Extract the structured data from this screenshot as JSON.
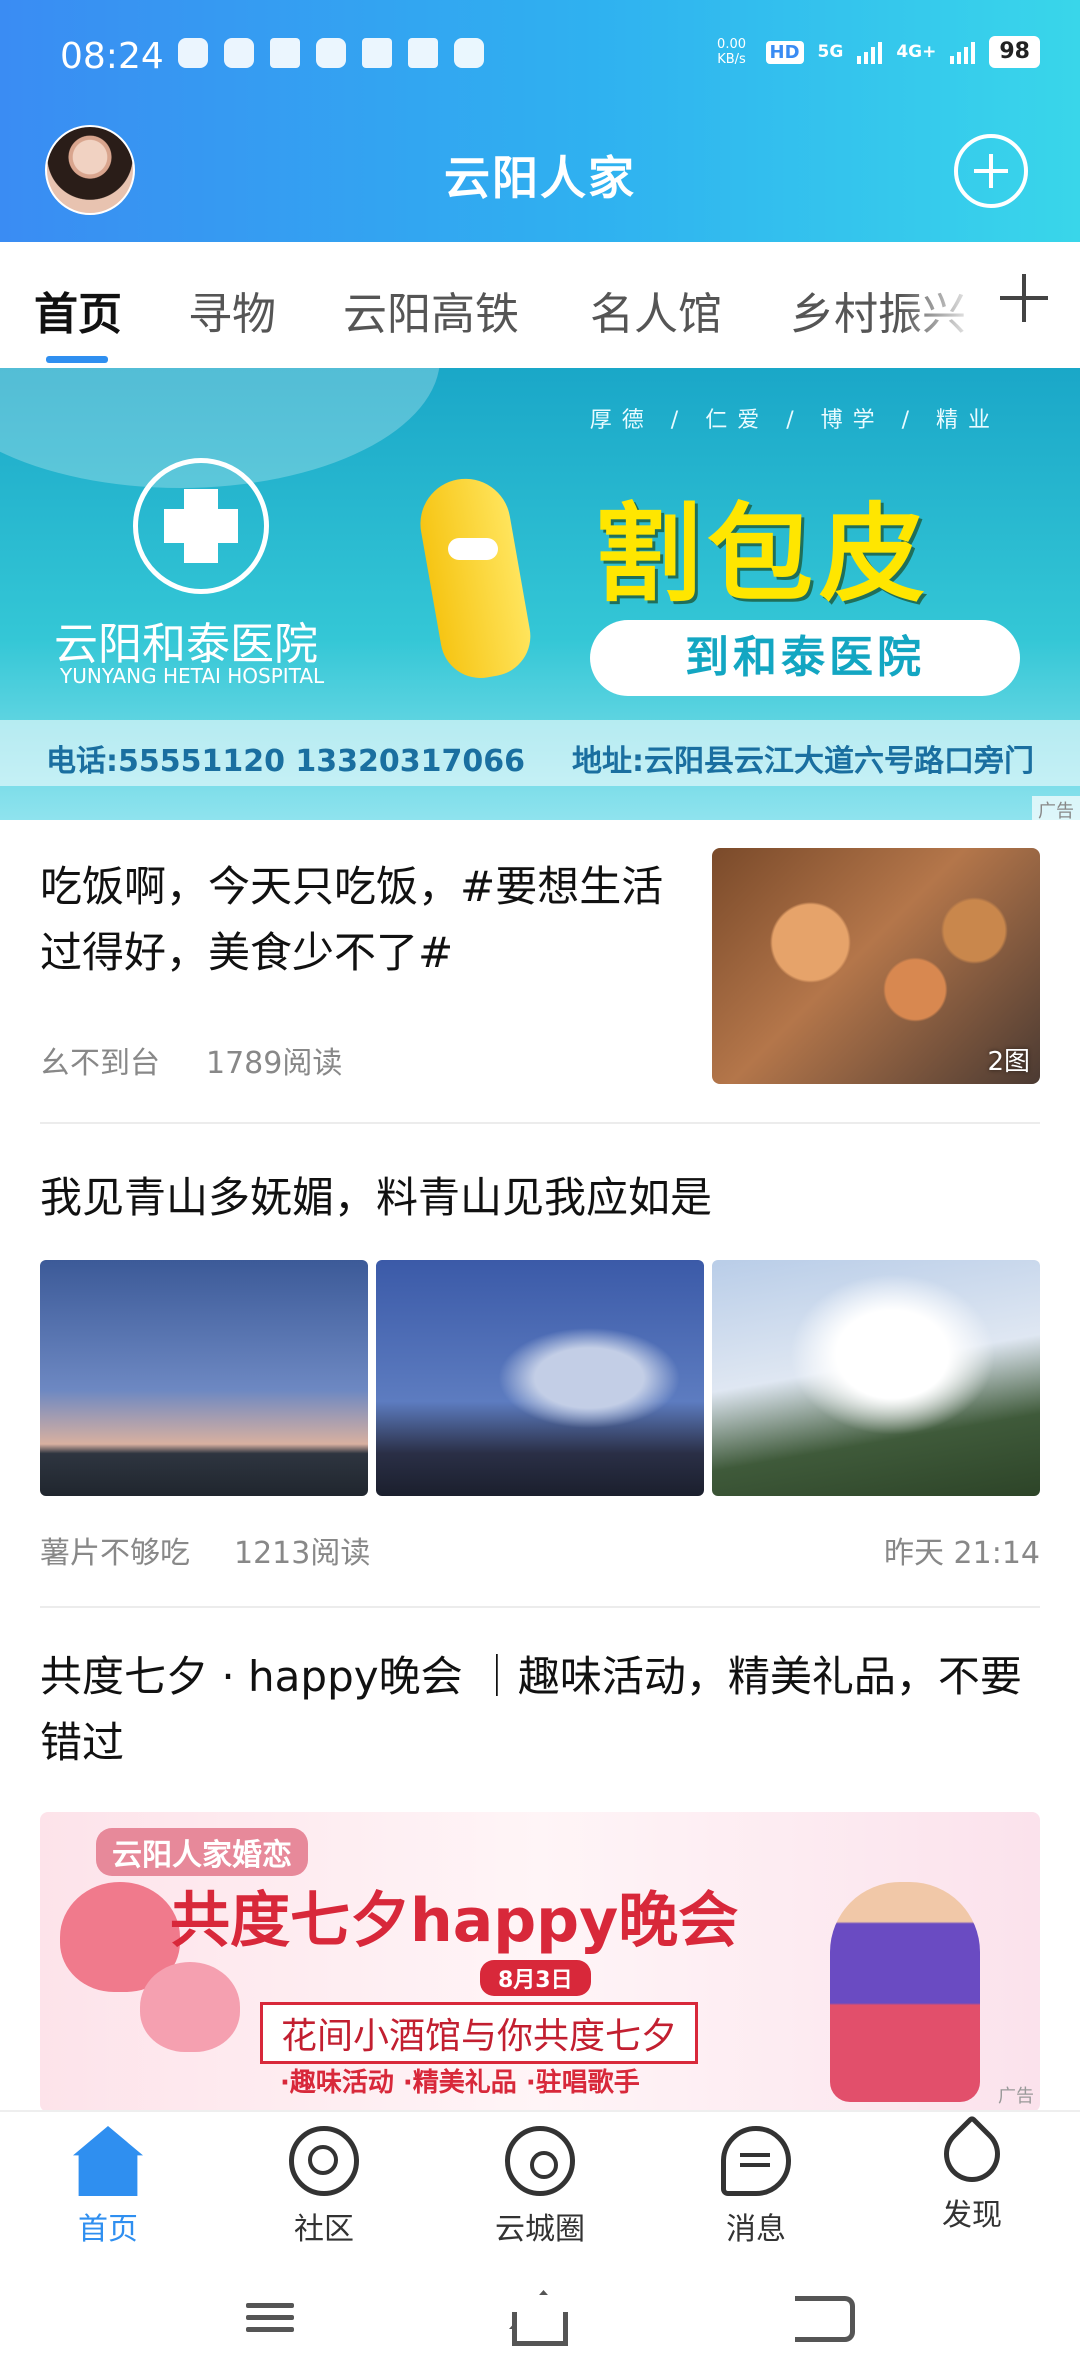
{
  "status_bar": {
    "time": "08:24",
    "net_speed_value": "0.00",
    "net_speed_unit": "KB/s",
    "hd_badge": "HD",
    "signal_1": "5G",
    "signal_2": "4G+",
    "battery": "98"
  },
  "header": {
    "title": "云阳人家"
  },
  "tabs": [
    {
      "label": "首页",
      "active": true
    },
    {
      "label": "寻物",
      "active": false
    },
    {
      "label": "云阳高铁",
      "active": false
    },
    {
      "label": "名人馆",
      "active": false
    },
    {
      "label": "乡村振兴",
      "active": false
    }
  ],
  "banner_ad": {
    "slogan": "厚德 / 仁爱 / 博学 / 精业",
    "hospital_name": "云阳和泰医院",
    "hospital_name_en": "YUNYANG HETAI HOSPITAL",
    "headline": "割包皮",
    "subheadline": "到和泰医院",
    "phone": "电话:55551120    13320317066",
    "address": "地址:云阳县云江大道六号路口旁门",
    "ad_label": "广告"
  },
  "feed": [
    {
      "title": "吃饭啊，今天只吃饭，#要想生活过得好，美食少不了#",
      "author": "幺不到台",
      "reads": "1789阅读",
      "image_count": "2图"
    },
    {
      "title": "我见青山多妩媚，料青山见我应如是",
      "author": "薯片不够吃",
      "reads": "1213阅读",
      "time": "昨天 21:14"
    },
    {
      "title": "共度七夕 · happy晚会 ｜趣味活动，精美礼品，不要错过",
      "banner": {
        "brand": "云阳人家婚恋",
        "headline": "共度七夕happy晚会",
        "date": "8月3日",
        "subtitle": "花间小酒馆与你共度七夕",
        "bullets": "·趣味活动  ·精美礼品  ·驻唱歌手",
        "ad_label": "广告"
      }
    }
  ],
  "bottom_nav": [
    {
      "label": "首页",
      "icon": "home-icon",
      "active": true
    },
    {
      "label": "社区",
      "icon": "community-icon",
      "active": false
    },
    {
      "label": "云城圈",
      "icon": "planet-icon",
      "active": false
    },
    {
      "label": "消息",
      "icon": "chat-bubble-icon",
      "active": false
    },
    {
      "label": "发现",
      "icon": "rocket-icon",
      "active": false
    }
  ],
  "colors": {
    "accent": "#2f8ff0",
    "header_gradient_start": "#3a8cf3",
    "header_gradient_end": "#39d6ea"
  }
}
